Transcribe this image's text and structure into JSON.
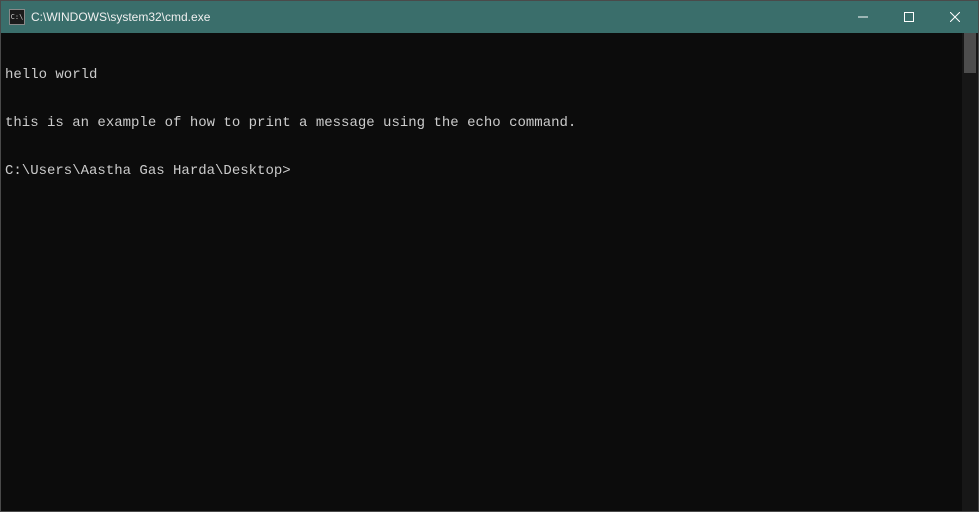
{
  "titlebar": {
    "icon_text": "C:\\",
    "title": "C:\\WINDOWS\\system32\\cmd.exe"
  },
  "terminal": {
    "lines": [
      "hello world",
      "this is an example of how to print a message using the echo command.",
      "C:\\Users\\Aastha Gas Harda\\Desktop>"
    ]
  }
}
